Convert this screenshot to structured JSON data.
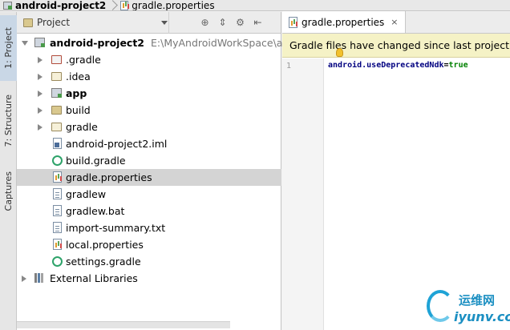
{
  "breadcrumb": {
    "project": "android-project2",
    "file": "gradle.properties"
  },
  "toolstrip": {
    "project_tab": "1: Project",
    "structure_tab": "7: Structure",
    "captures_tab": "Captures"
  },
  "panel": {
    "view_label": "Project",
    "icons": [
      "globe-icon",
      "collapse-icon",
      "gear-icon",
      "hide-icon"
    ]
  },
  "tree": {
    "root": {
      "label": "android-project2",
      "path": "E:\\MyAndroidWorkSpace\\andr"
    },
    "items": [
      {
        "label": ".gradle",
        "icon": "folder-excluded-icon"
      },
      {
        "label": ".idea",
        "icon": "folder-icon"
      },
      {
        "label": "app",
        "icon": "module-icon"
      },
      {
        "label": "build",
        "icon": "folder-icon"
      },
      {
        "label": "gradle",
        "icon": "folder-icon"
      },
      {
        "label": "android-project2.iml",
        "icon": "iml-file-icon"
      },
      {
        "label": "build.gradle",
        "icon": "gradle-file-icon"
      },
      {
        "label": "gradle.properties",
        "icon": "properties-file-icon"
      },
      {
        "label": "gradlew",
        "icon": "text-file-icon"
      },
      {
        "label": "gradlew.bat",
        "icon": "text-file-icon"
      },
      {
        "label": "import-summary.txt",
        "icon": "text-file-icon"
      },
      {
        "label": "local.properties",
        "icon": "properties-file-icon"
      },
      {
        "label": "settings.gradle",
        "icon": "gradle-file-icon"
      }
    ],
    "external": {
      "label": "External Libraries"
    }
  },
  "editor": {
    "tab_label": "gradle.properties",
    "close_glyph": "×",
    "notification": "Gradle files have changed since last project sync",
    "line_number": "1",
    "code": {
      "key": "android.useDeprecatedNdk",
      "eq": "=",
      "value": "true"
    }
  },
  "watermark": {
    "cn": "运维网",
    "en": "iyunv.com"
  },
  "colors": {
    "selection": "#d4d4d4",
    "notification_bg": "#f5f2c6",
    "code_key": "#000080",
    "code_value": "#008000"
  }
}
